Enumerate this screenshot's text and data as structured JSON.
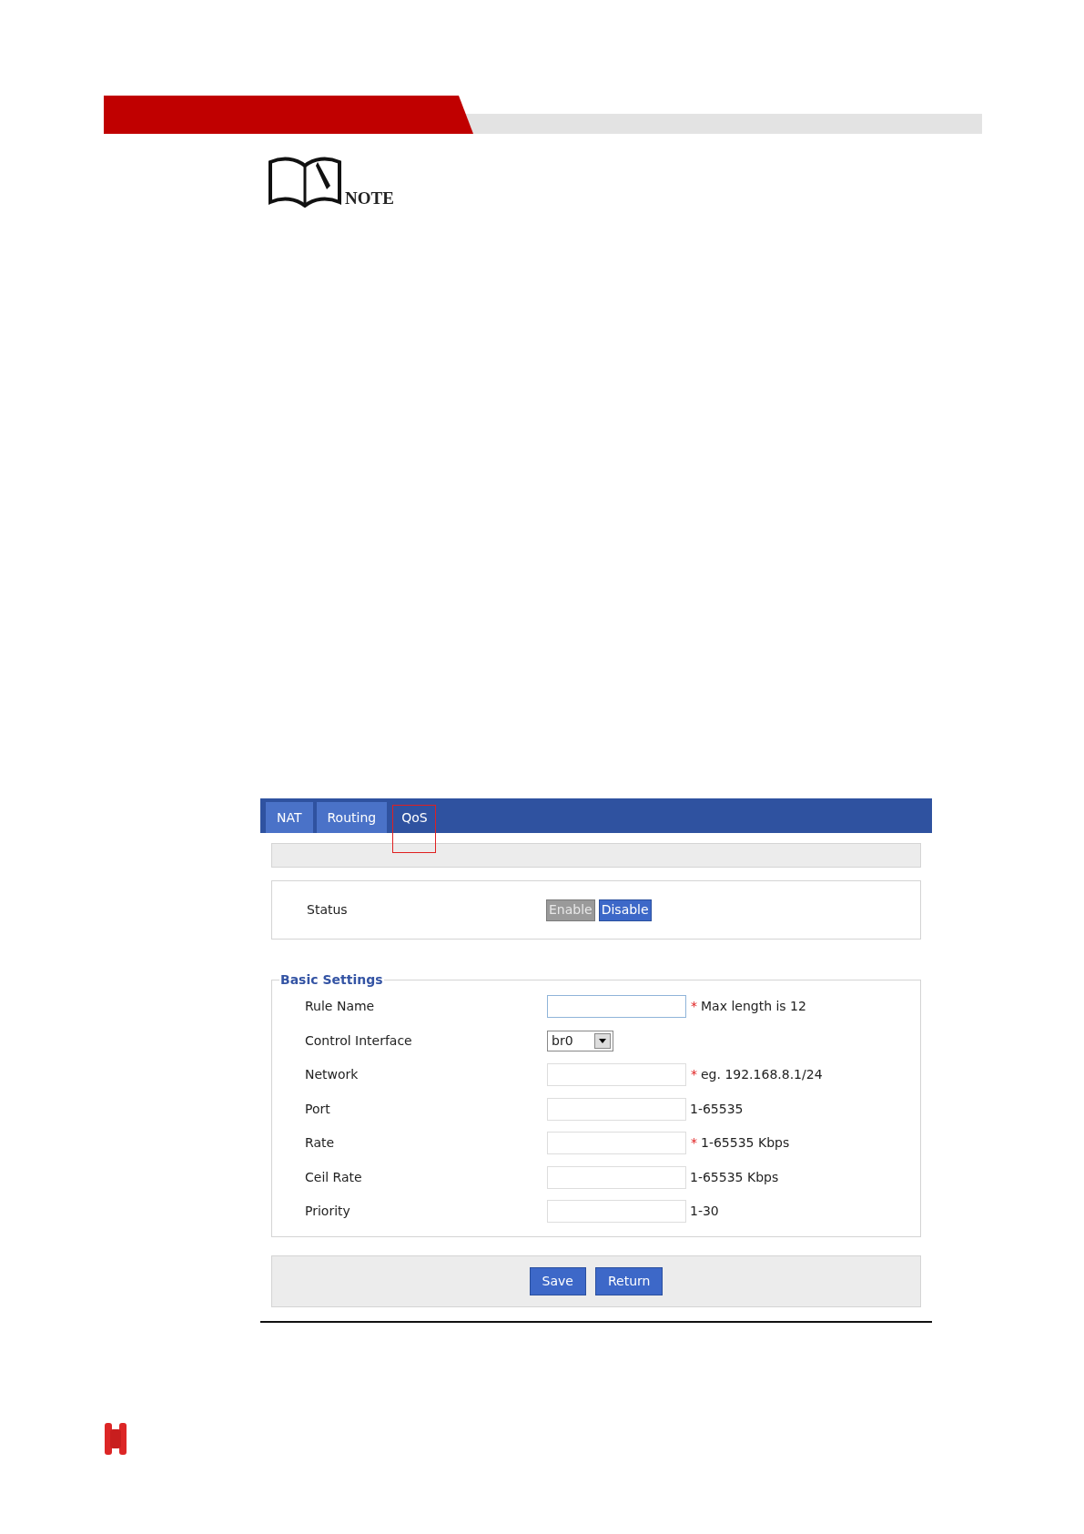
{
  "note": {
    "label": "NOTE"
  },
  "tabs": [
    {
      "label": "NAT",
      "selected": false,
      "highlighted": false
    },
    {
      "label": "Routing",
      "selected": false,
      "highlighted": false
    },
    {
      "label": "QoS",
      "selected": true,
      "highlighted": true
    }
  ],
  "status": {
    "label": "Status",
    "options": [
      {
        "label": "Enable",
        "selected": false
      },
      {
        "label": "Disable",
        "selected": true
      }
    ]
  },
  "basic_settings": {
    "title": "Basic Settings",
    "fields": [
      {
        "label": "Rule Name",
        "kind": "text",
        "mark": "*",
        "hint": "Max length is 12",
        "focused": true
      },
      {
        "label": "Control Interface",
        "kind": "select",
        "value": "br0"
      },
      {
        "label": "Network",
        "kind": "text",
        "mark": "*",
        "hint": "eg. 192.168.8.1/24",
        "focused": false
      },
      {
        "label": "Port",
        "kind": "text",
        "hint": "1-65535",
        "focused": false
      },
      {
        "label": "Rate",
        "kind": "text",
        "mark": "*",
        "hint": "1-65535 Kbps",
        "focused": false
      },
      {
        "label": "Ceil Rate",
        "kind": "text",
        "hint": "1-65535 Kbps",
        "focused": false
      },
      {
        "label": "Priority",
        "kind": "text",
        "hint": "1-30",
        "focused": false
      }
    ]
  },
  "buttons": [
    "Save",
    "Return"
  ]
}
